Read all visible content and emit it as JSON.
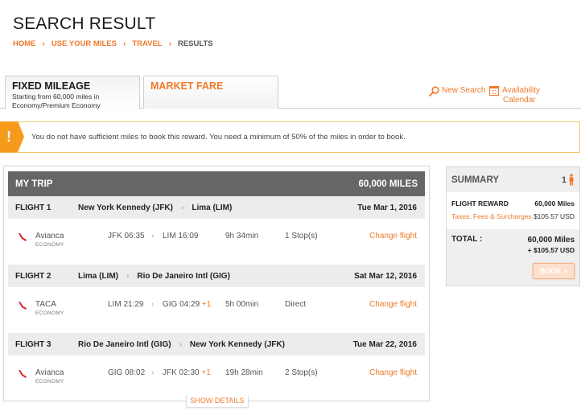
{
  "page": {
    "title": "SEARCH RESULT",
    "breadcrumb": [
      {
        "label": "HOME"
      },
      {
        "label": "USE YOUR MILES"
      },
      {
        "label": "TRAVEL"
      },
      {
        "label": "RESULTS"
      }
    ],
    "breadcrumb_separator": "›"
  },
  "tabs": [
    {
      "title": "FIXED MILEAGE",
      "subtitle_line1": "Starting from  60,000 miles in",
      "subtitle_line2": "Economy/Premium Economy",
      "active": true
    },
    {
      "title": "MARKET FARE",
      "active": false
    }
  ],
  "tools": {
    "new_search": "New Search",
    "availability_line1": "Availability",
    "availability_line2": "Calendar"
  },
  "alert": {
    "icon": "!",
    "message": "You do not have sufficient miles to book this reward. You need a minimum of 50% of the miles in order to book."
  },
  "trip": {
    "header_label": "MY TRIP",
    "header_miles": "60,000 MILES",
    "route_separator": "›",
    "flights": [
      {
        "number": "FLIGHT 1",
        "origin": "New York Kennedy (JFK)",
        "destination": "Lima (LIM)",
        "date": "Tue Mar 1, 2016",
        "airline": "Avianca",
        "cabin": "ECONOMY",
        "depart": "JFK 06:35",
        "arrive": "LIM 16:09",
        "day_offset": "",
        "duration": "9h 34min",
        "stops": "1 Stop(s)",
        "change_label": "Change flight"
      },
      {
        "number": "FLIGHT 2",
        "origin": "Lima (LIM)",
        "destination": "Rio De Janeiro Intl (GIG)",
        "date": "Sat Mar 12, 2016",
        "airline": "TACA",
        "cabin": "ECONOMY",
        "depart": "LIM 21:29",
        "arrive": "GIG 04:29",
        "day_offset": "+1",
        "duration": "5h 00min",
        "stops": "Direct",
        "change_label": "Change flight"
      },
      {
        "number": "FLIGHT 3",
        "origin": "Rio De Janeiro Intl (GIG)",
        "destination": "New York Kennedy (JFK)",
        "date": "Tue Mar 22, 2016",
        "airline": "Avianca",
        "cabin": "ECONOMY",
        "depart": "GIG 08:02",
        "arrive": "JFK 02:30",
        "day_offset": "+1",
        "duration": "19h 28min",
        "stops": "2 Stop(s)",
        "change_label": "Change flight"
      }
    ],
    "show_details": "SHOW DETAILS"
  },
  "summary": {
    "title": "SUMMARY",
    "passengers": "1",
    "flight_reward_label": "FLIGHT REWARD",
    "flight_reward_value": "60,000 Miles",
    "taxes_label": "Taxes, Fees & Surcharges",
    "taxes_value": "$105.57 USD",
    "total_label": "TOTAL :",
    "total_miles": "60,000  Miles",
    "total_cash": "+ $105.57  USD",
    "book_label": "BOOK >"
  },
  "colors": {
    "accent": "#f07a2c",
    "warning": "#f59a1b",
    "header_bg": "#666666"
  }
}
